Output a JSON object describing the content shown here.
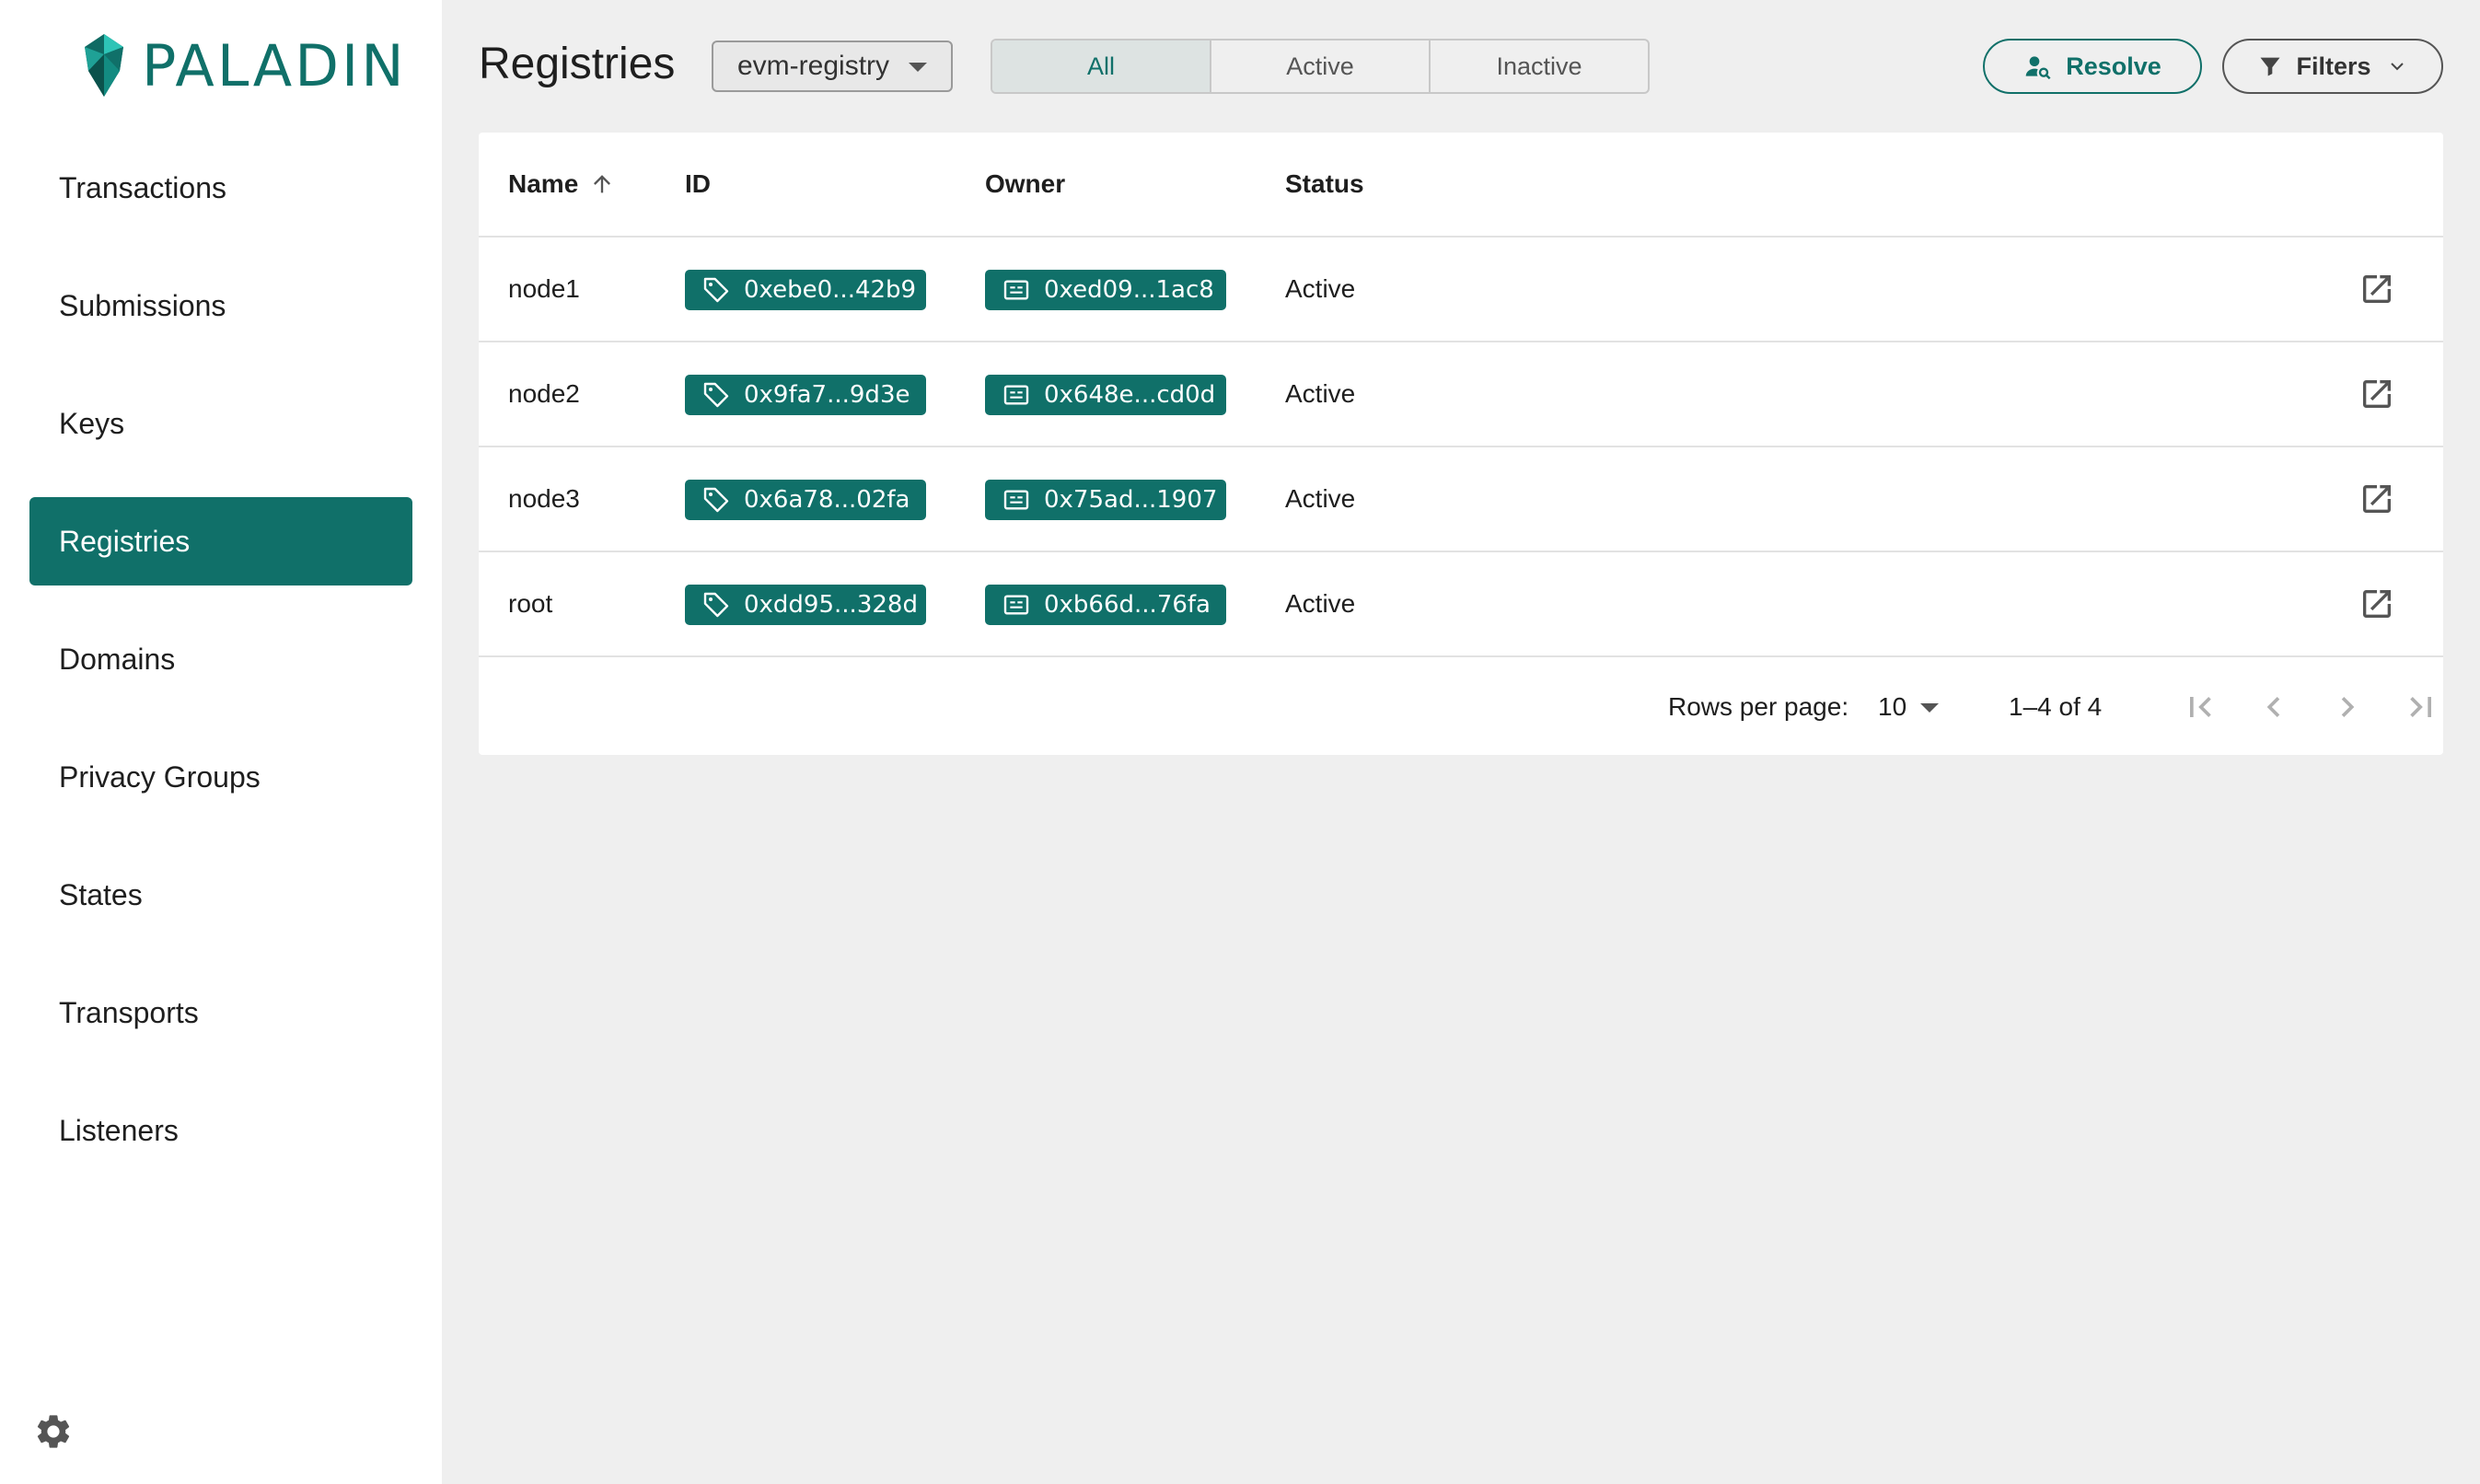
{
  "app": {
    "logo_text": "PALADIN"
  },
  "sidebar": {
    "items": [
      {
        "label": "Transactions"
      },
      {
        "label": "Submissions"
      },
      {
        "label": "Keys"
      },
      {
        "label": "Registries"
      },
      {
        "label": "Domains"
      },
      {
        "label": "Privacy Groups"
      },
      {
        "label": "States"
      },
      {
        "label": "Transports"
      },
      {
        "label": "Listeners"
      }
    ],
    "active": "Registries",
    "settings_icon": "gear-icon"
  },
  "header": {
    "title": "Registries",
    "registry_select": {
      "value": "evm-registry"
    },
    "status_toggle": {
      "options": [
        "All",
        "Active",
        "Inactive"
      ],
      "selected": "All"
    },
    "resolve_label": "Resolve",
    "filters_label": "Filters"
  },
  "table": {
    "columns": {
      "name": "Name",
      "id": "ID",
      "owner": "Owner",
      "status": "Status"
    },
    "sort": {
      "column": "Name",
      "direction": "ascending"
    },
    "rows": [
      {
        "name": "node1",
        "id": "0xebe0...42b9",
        "owner": "0xed09...1ac8",
        "status": "Active"
      },
      {
        "name": "node2",
        "id": "0x9fa7...9d3e",
        "owner": "0x648e...cd0d",
        "status": "Active"
      },
      {
        "name": "node3",
        "id": "0x6a78...02fa",
        "owner": "0x75ad...1907",
        "status": "Active"
      },
      {
        "name": "root",
        "id": "0xdd95...328d",
        "owner": "0xb66d...76fa",
        "status": "Active"
      }
    ]
  },
  "pagination": {
    "rows_per_page_label": "Rows per page:",
    "rows_per_page": "10",
    "range": "1–4 of 4"
  },
  "colors": {
    "brand": "#107069",
    "background": "#efefef",
    "card": "#ffffff"
  }
}
